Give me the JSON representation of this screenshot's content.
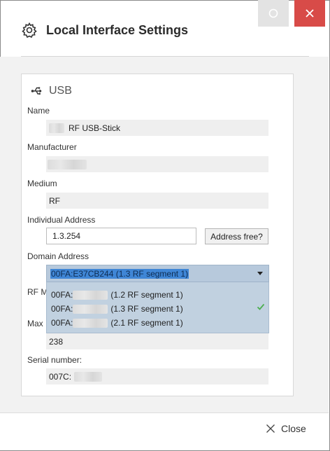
{
  "window": {
    "title": "Local Interface Settings",
    "restore_icon": "restore-icon",
    "close_icon": "close-icon"
  },
  "section": {
    "title": "USB",
    "icon": "usb-icon"
  },
  "fields": {
    "name_label": "Name",
    "name_value": "RF USB-Stick",
    "manufacturer_label": "Manufacturer",
    "medium_label": "Medium",
    "medium_value": "RF",
    "individual_address_label": "Individual Address",
    "individual_address_value": "1.3.254",
    "address_free_button": "Address free?",
    "domain_address_label": "Domain Address",
    "domain_selected": "00FA:E37CB244 (1.3 RF segment 1)",
    "domain_options": [
      {
        "prefix": "00FA:",
        "suffix": "(1.2 RF segment 1)",
        "selected": false
      },
      {
        "prefix": "00FA:",
        "suffix": "(1.3 RF segment 1)",
        "selected": true
      },
      {
        "prefix": "00FA:",
        "suffix": "(2.1 RF segment 1)",
        "selected": false
      }
    ],
    "rf_label_partial": "RF M",
    "max_label_partial": "Max",
    "max_value": "238",
    "serial_label": "Serial number:",
    "serial_prefix": "007C:"
  },
  "footer": {
    "close_label": "Close"
  },
  "colors": {
    "close_button": "#d84b48",
    "selection": "#3f86d6",
    "dropdown_bg": "#c1d1e0",
    "check": "#4caf50"
  }
}
